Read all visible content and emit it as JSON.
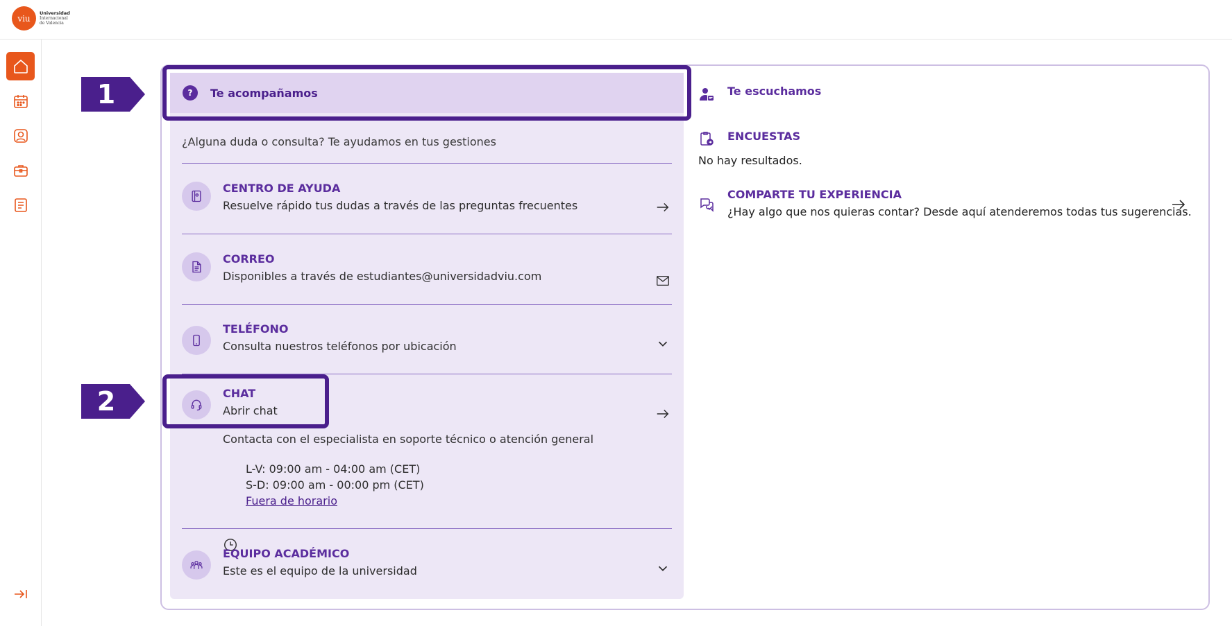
{
  "header": {
    "logo_mark": "viu",
    "logo_line1": "Universidad",
    "logo_line2": "Internacional",
    "logo_line3": "de Valencia"
  },
  "sidebar": {
    "items": [
      {
        "name": "home",
        "icon": "home-icon",
        "active": true
      },
      {
        "name": "calendar",
        "icon": "calendar-icon",
        "active": false
      },
      {
        "name": "profile",
        "icon": "user-icon",
        "active": false
      },
      {
        "name": "career",
        "icon": "briefcase-icon",
        "active": false
      },
      {
        "name": "documents",
        "icon": "document-icon",
        "active": false
      }
    ],
    "collapse_icon": "collapse-arrow-icon"
  },
  "left_panel": {
    "tab_label": "Te acompañamos",
    "intro": "¿Alguna duda o consulta? Te ayudamos en tus gestiones",
    "items": [
      {
        "title": "CENTRO DE AYUDA",
        "subtitle": "Resuelve rápido tus dudas a través de las preguntas frecuentes",
        "action": "arrow-right-icon"
      },
      {
        "title": "CORREO",
        "subtitle": "Disponibles a través de estudiantes@universidadviu.com",
        "action": "mail-icon"
      },
      {
        "title": "TELÉFONO",
        "subtitle": "Consulta nuestros teléfonos por ubicación",
        "action": "chevron-down-icon"
      },
      {
        "title": "CHAT",
        "subtitle": "Abrir chat",
        "action": "arrow-right-icon"
      },
      {
        "title": "EQUIPO ACADÉMICO",
        "subtitle": "Este es el equipo de la universidad",
        "action": "chevron-down-icon"
      }
    ],
    "chat": {
      "description": "Contacta con el especialista en soporte técnico o atención general",
      "hours_weekdays": "L-V: 09:00 am - 04:00 am (CET)",
      "hours_weekend": "S-D: 09:00 am - 00:00 pm (CET)",
      "out_of_hours_link": "Fuera de horario"
    }
  },
  "right_panel": {
    "tab_label": "Te escuchamos",
    "surveys_title": "ENCUESTAS",
    "surveys_empty": "No hay resultados.",
    "share_title": "COMPARTE TU EXPERIENCIA",
    "share_text": "¿Hay algo que nos quieras contar? Desde aquí atenderemos todas tus sugerencias."
  },
  "annotations": {
    "marker1": "1",
    "marker2": "2",
    "color": "#4a1f8c"
  },
  "colors": {
    "brand_orange": "#e8571c",
    "brand_purple": "#5b2d9e",
    "panel_bg": "#ede7f6"
  }
}
